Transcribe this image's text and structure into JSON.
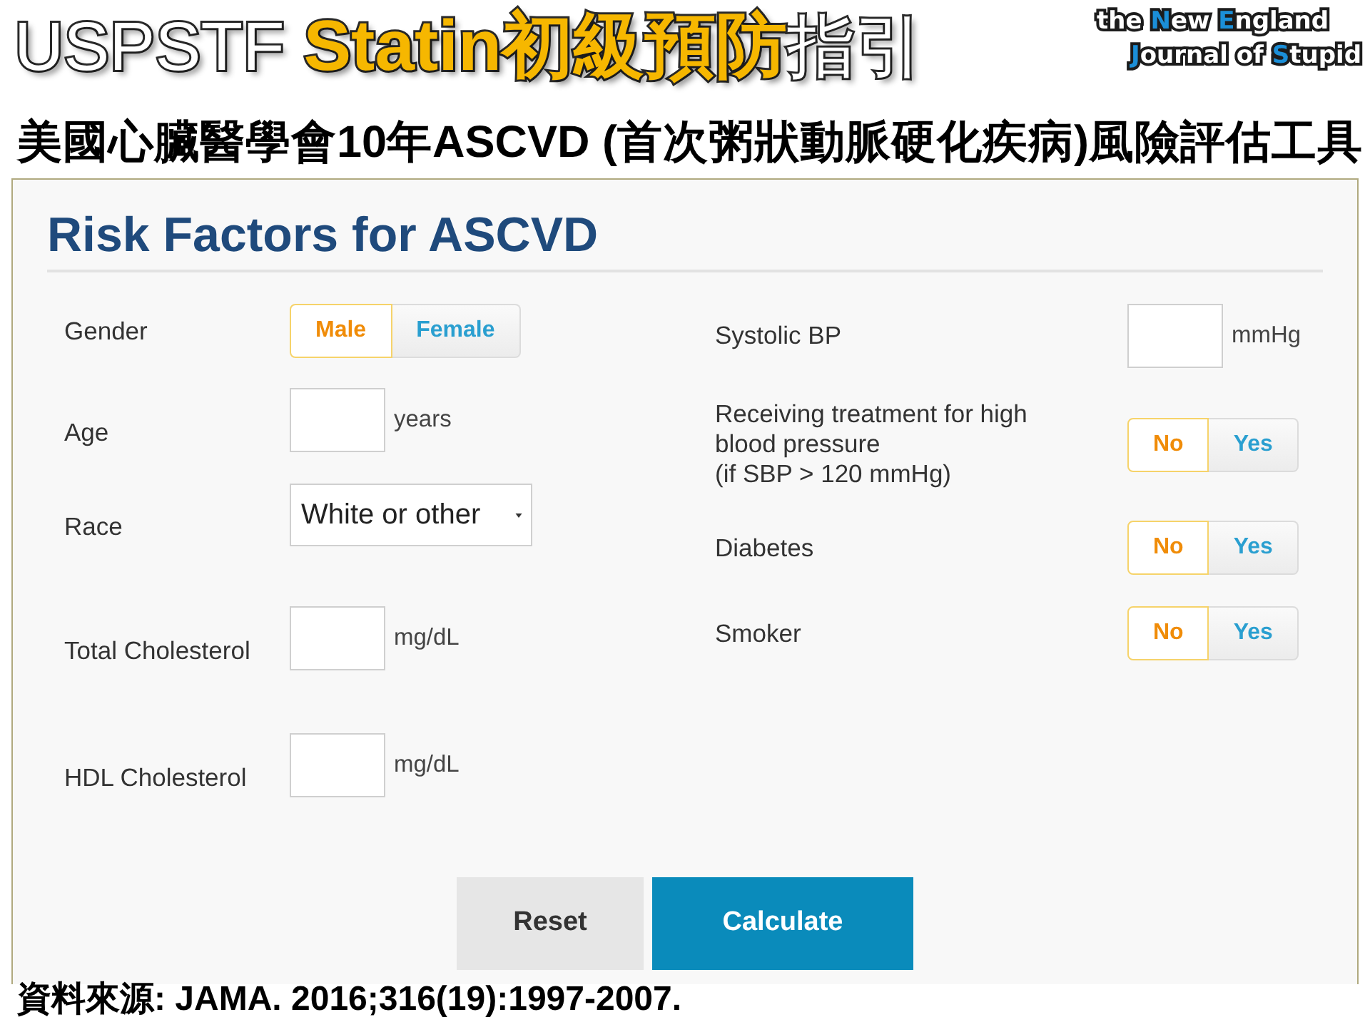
{
  "header": {
    "title": [
      {
        "text": "USPSTF ",
        "highlight": false
      },
      {
        "text": "Statin初級預防",
        "highlight": true
      },
      {
        "text": "指引",
        "highlight": false
      }
    ],
    "logo": {
      "lines": [
        [
          {
            "text": "the ",
            "accent": false
          },
          {
            "text": "N",
            "accent": true
          },
          {
            "text": "ew ",
            "accent": false
          },
          {
            "text": "E",
            "accent": true
          },
          {
            "text": "ngland",
            "accent": false
          }
        ],
        [
          {
            "text": "J",
            "accent": true
          },
          {
            "text": "ournal of ",
            "accent": false
          },
          {
            "text": "S",
            "accent": true
          },
          {
            "text": "tupid",
            "accent": false
          }
        ]
      ]
    }
  },
  "subtitle": "美國心臟醫學會10年ASCVD (首次粥狀動脈硬化疾病)風險評估工具",
  "calculator": {
    "heading": "Risk Factors for ASCVD",
    "left_fields": [
      {
        "kind": "toggle",
        "label": "Gender",
        "options": [
          {
            "label": "Male",
            "selected": true
          },
          {
            "label": "Female",
            "selected": false
          }
        ]
      },
      {
        "kind": "input",
        "label": "Age",
        "unit": "years"
      },
      {
        "kind": "select",
        "label": "Race",
        "value": "White or other"
      },
      {
        "kind": "input",
        "label": "Total Cholesterol",
        "unit": "mg/dL"
      },
      {
        "kind": "input",
        "label": "HDL Cholesterol",
        "unit": "mg/dL"
      }
    ],
    "right_fields": [
      {
        "kind": "input",
        "label": "Systolic BP",
        "unit": "mmHg"
      },
      {
        "kind": "toggle",
        "label": "Receiving treatment for high\nblood pressure\n(if SBP > 120 mmHg)",
        "options": [
          {
            "label": "No",
            "selected": true
          },
          {
            "label": "Yes",
            "selected": false
          }
        ]
      },
      {
        "kind": "toggle",
        "label": "Diabetes",
        "options": [
          {
            "label": "No",
            "selected": true
          },
          {
            "label": "Yes",
            "selected": false
          }
        ]
      },
      {
        "kind": "toggle",
        "label": "Smoker",
        "options": [
          {
            "label": "No",
            "selected": true
          },
          {
            "label": "Yes",
            "selected": false
          }
        ]
      }
    ],
    "buttons": [
      {
        "kind": "secondary",
        "label": "Reset"
      },
      {
        "kind": "primary",
        "label": "Calculate"
      }
    ]
  },
  "source": "資料來源: JAMA. 2016;316(19):1997-2007."
}
